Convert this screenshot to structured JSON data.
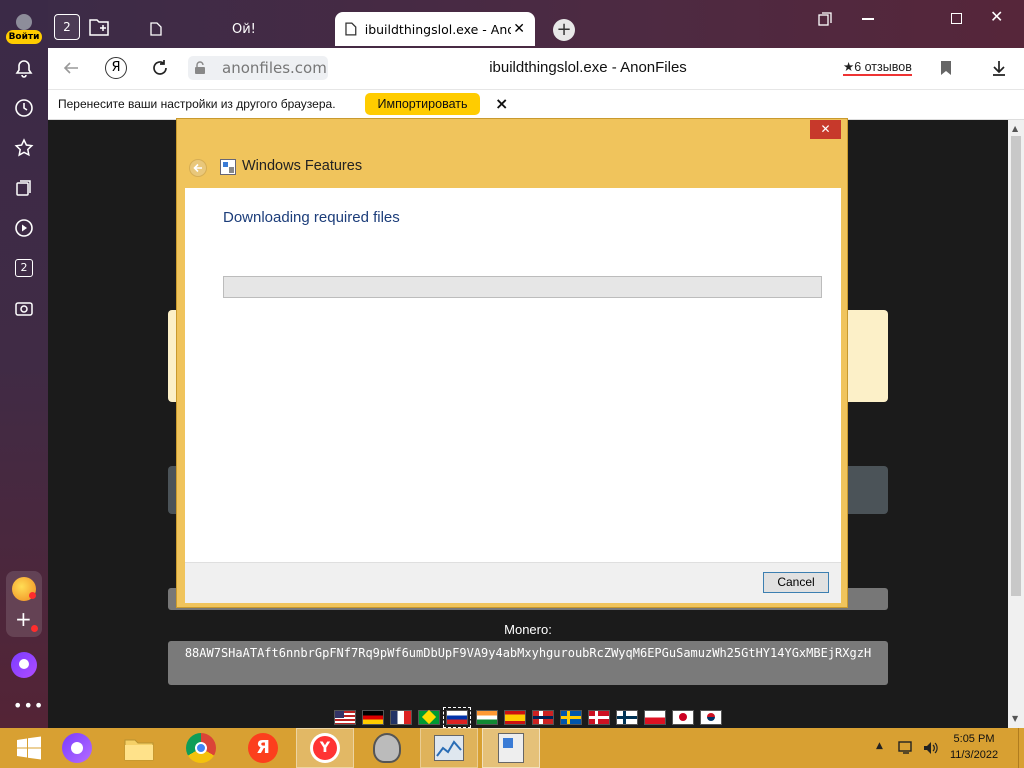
{
  "browser": {
    "login_label": "Войти",
    "tab_count": "2",
    "tabs": [
      {
        "title": "Ой!"
      },
      {
        "title": "ibuildthingslol.exe - Anon"
      }
    ],
    "address_domain": "anonfiles.com",
    "page_title": "ibuildthingslol.exe - AnonFiles",
    "reviews_label": "★6 отзывов",
    "sidebar_badge": "2",
    "import_prompt": "Перенесите ваши настройки из другого браузера.",
    "import_button": "Импортировать",
    "close_symbol": "×"
  },
  "dialog": {
    "title": "Windows Features",
    "heading": "Downloading required files",
    "progress": 0,
    "cancel_label": "Cancel",
    "close_symbol": "✕"
  },
  "page": {
    "monero_label": "Monero:",
    "monero_address": "88AW7SHaATAft6nnbrGpFNf7Rq9pWf6umDbUpF9VA9y4abMxyhguroubRcZWyqM6EPGuSamuzWh25GtHY14YGxMBEjRXgzH",
    "flags": [
      "us-flag",
      "de-flag",
      "fr-flag",
      "br-flag",
      "ru-flag",
      "in-flag",
      "es-flag",
      "no-flag",
      "se-flag",
      "dk-flag",
      "fi-flag",
      "pl-flag",
      "jp-flag",
      "kr-flag"
    ]
  },
  "taskbar": {
    "time": "5:05 PM",
    "date": "11/3/2022"
  },
  "colors": {
    "dialog_frame": "#f0c45c",
    "heading_blue": "#1c3d7a",
    "import_button_bg": "#ffcc00",
    "taskbar": "#d8a032",
    "close_red": "#c7392b"
  }
}
